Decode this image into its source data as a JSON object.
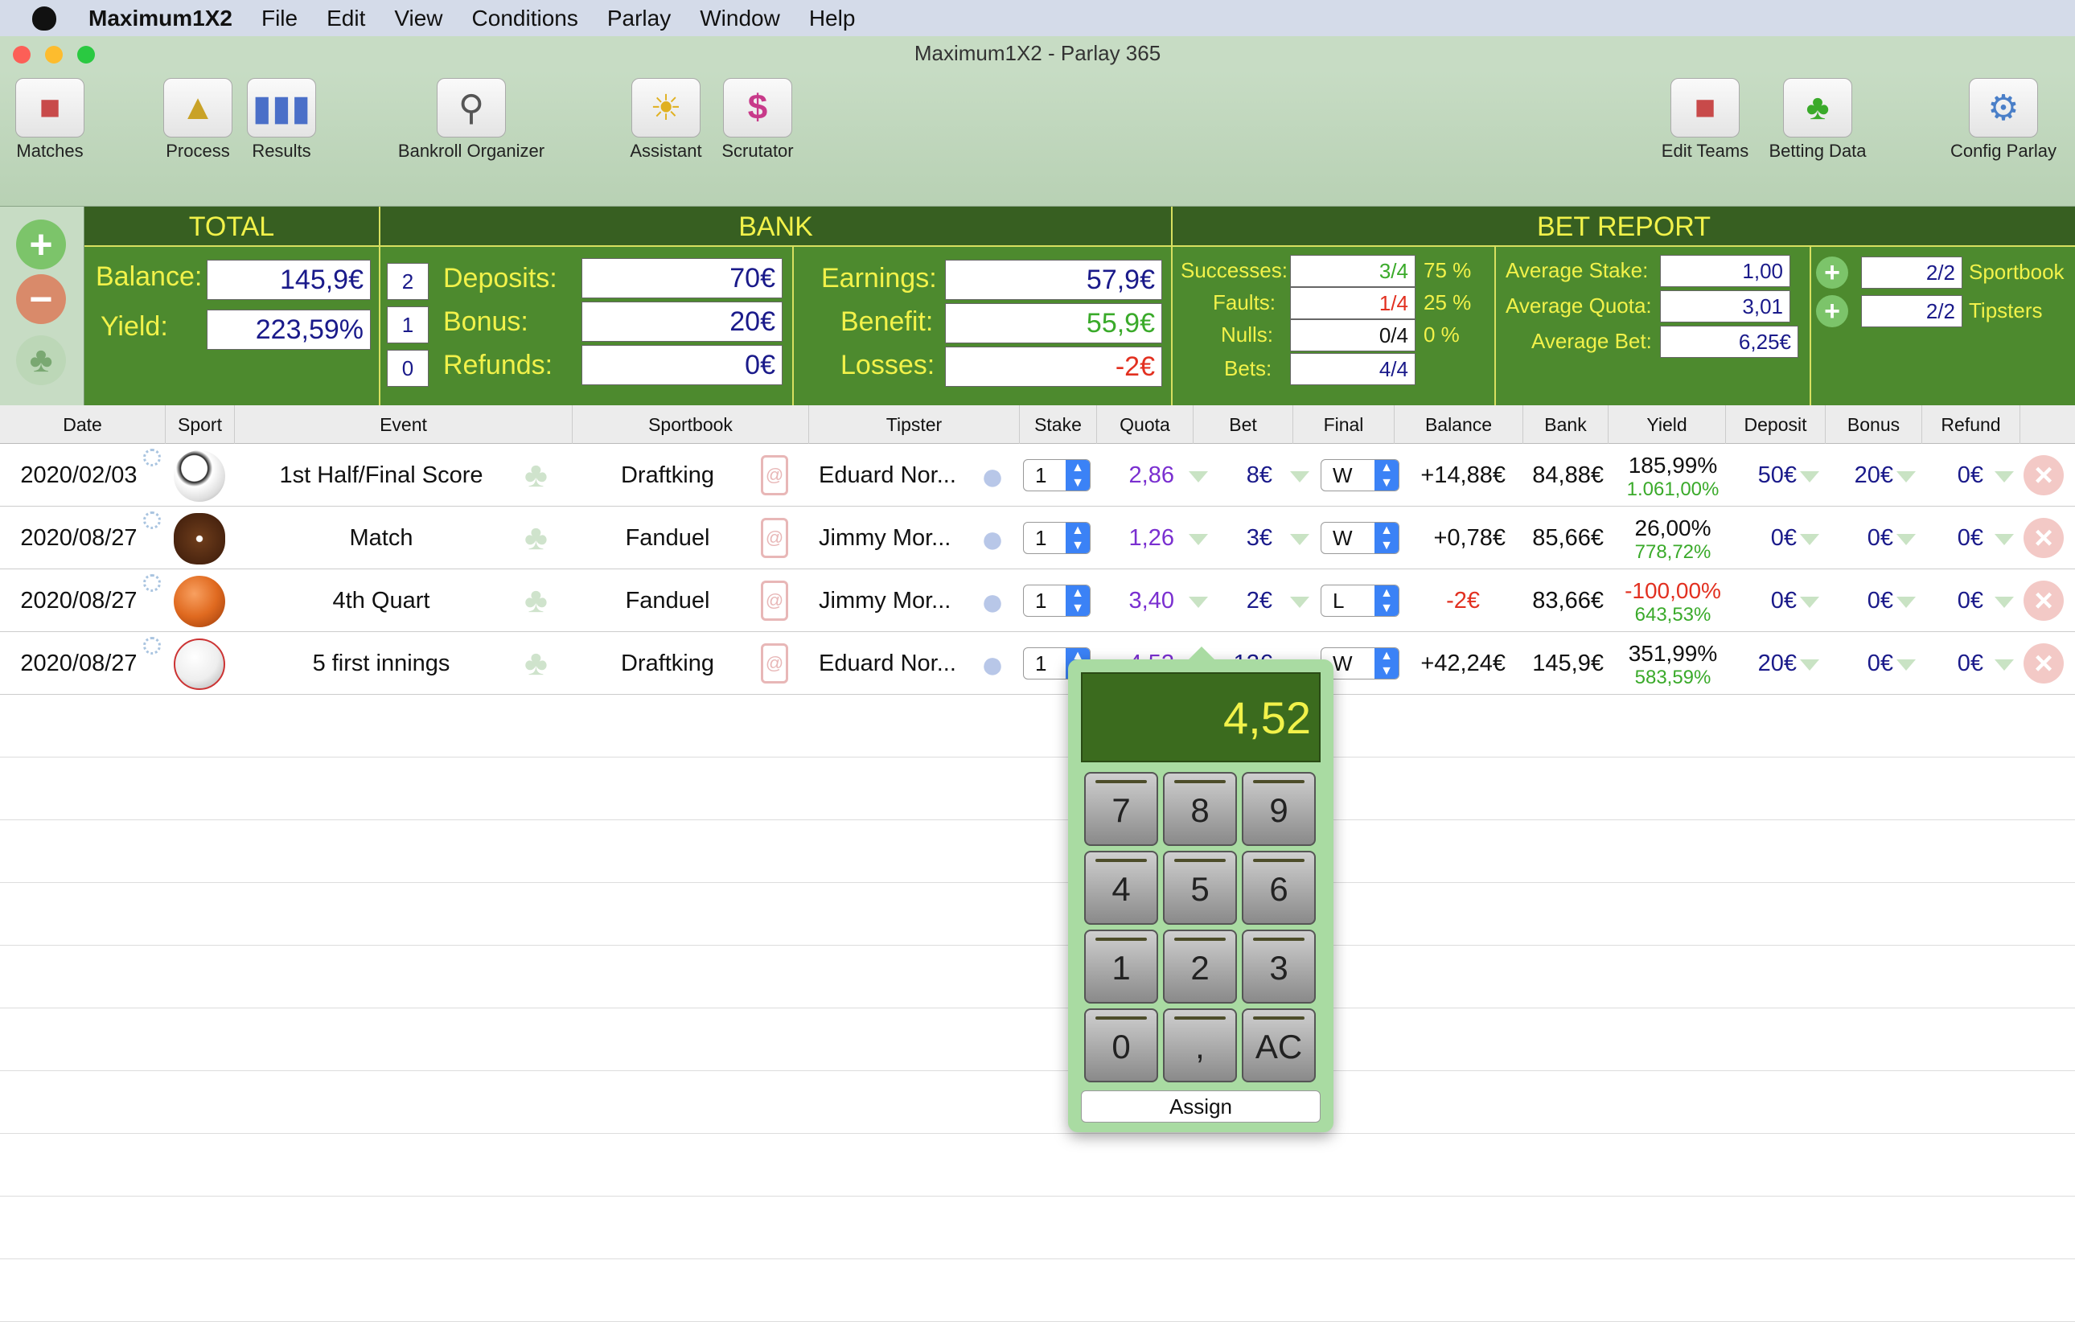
{
  "menubar": {
    "app": "Maximum1X2",
    "items": [
      "File",
      "Edit",
      "View",
      "Conditions",
      "Parlay",
      "Window",
      "Help"
    ]
  },
  "window": {
    "title": "Maximum1X2 - Parlay 365"
  },
  "toolbar": {
    "matches": "Matches",
    "process": "Process",
    "results": "Results",
    "bankroll": "Bankroll Organizer",
    "assistant": "Assistant",
    "scrutator": "Scrutator",
    "edit_teams": "Edit Teams",
    "betting_data": "Betting Data",
    "config": "Config Parlay"
  },
  "total": {
    "header": "TOTAL",
    "balance_label": "Balance:",
    "balance": "145,9€",
    "yield_label": "Yield:",
    "yield": "223,59%"
  },
  "bank": {
    "header": "BANK",
    "deposits_count": "2",
    "deposits_label": "Deposits:",
    "deposits": "70€",
    "bonus_count": "1",
    "bonus_label": "Bonus:",
    "bonus": "20€",
    "refunds_count": "0",
    "refunds_label": "Refunds:",
    "refunds": "0€",
    "earnings_label": "Earnings:",
    "earnings": "57,9€",
    "benefit_label": "Benefit:",
    "benefit": "55,9€",
    "losses_label": "Losses:",
    "losses": "-2€"
  },
  "report": {
    "header": "BET REPORT",
    "successes_label": "Successes:",
    "successes": "3/4",
    "successes_pct": "75 %",
    "faults_label": "Faults:",
    "faults": "1/4",
    "faults_pct": "25 %",
    "nulls_label": "Nulls:",
    "nulls": "0/4",
    "nulls_pct": "0 %",
    "bets_label": "Bets:",
    "bets": "4/4",
    "avg_stake_label": "Average Stake:",
    "avg_stake": "1,00",
    "avg_quota_label": "Average Quota:",
    "avg_quota": "3,01",
    "avg_bet_label": "Average Bet:",
    "avg_bet": "6,25€",
    "sportbook_val": "2/2",
    "sportbook_label": "Sportbook",
    "tipsters_val": "2/2",
    "tipsters_label": "Tipsters"
  },
  "columns": [
    "Date",
    "Sport",
    "Event",
    "Sportbook",
    "Tipster",
    "Stake",
    "Quota",
    "Bet",
    "Final",
    "Balance",
    "Bank",
    "Yield",
    "Deposit",
    "Bonus",
    "Refund"
  ],
  "rows": [
    {
      "date": "2020/02/03",
      "sport_icon": "soccer-ball-icon",
      "event": "1st Half/Final Score",
      "sportbook": "Draftking",
      "tipster": "Eduard Nor...",
      "stake": "1",
      "quota": "2,86",
      "bet": "8€",
      "final": "W",
      "balance": "+14,88€",
      "bank": "84,88€",
      "yield": "185,99%",
      "yield2": "1.061,00%",
      "deposit": "50€",
      "bonus": "20€",
      "refund": "0€"
    },
    {
      "date": "2020/08/27",
      "sport_icon": "american-football-icon",
      "event": "Match",
      "sportbook": "Fanduel",
      "tipster": "Jimmy Mor...",
      "stake": "1",
      "quota": "1,26",
      "bet": "3€",
      "final": "W",
      "balance": "+0,78€",
      "bank": "85,66€",
      "yield": "26,00%",
      "yield2": "778,72%",
      "deposit": "0€",
      "bonus": "0€",
      "refund": "0€"
    },
    {
      "date": "2020/08/27",
      "sport_icon": "basketball-icon",
      "event": "4th Quart",
      "sportbook": "Fanduel",
      "tipster": "Jimmy Mor...",
      "stake": "1",
      "quota": "3,40",
      "bet": "2€",
      "final": "L",
      "balance": "-2€",
      "bank": "83,66€",
      "yield": "-100,00%",
      "yield2": "643,53%",
      "deposit": "0€",
      "bonus": "0€",
      "refund": "0€"
    },
    {
      "date": "2020/08/27",
      "sport_icon": "baseball-icon",
      "event": "5 first innings",
      "sportbook": "Draftking",
      "tipster": "Eduard Nor...",
      "stake": "1",
      "quota": "4,52",
      "bet": "12€",
      "final": "W",
      "balance": "+42,24€",
      "bank": "145,9€",
      "yield": "351,99%",
      "yield2": "583,59%",
      "deposit": "20€",
      "bonus": "0€",
      "refund": "0€"
    }
  ],
  "calculator": {
    "display": "4,52",
    "keys": [
      "7",
      "8",
      "9",
      "4",
      "5",
      "6",
      "1",
      "2",
      "3",
      "0",
      ",",
      "AC"
    ],
    "assign": "Assign"
  }
}
